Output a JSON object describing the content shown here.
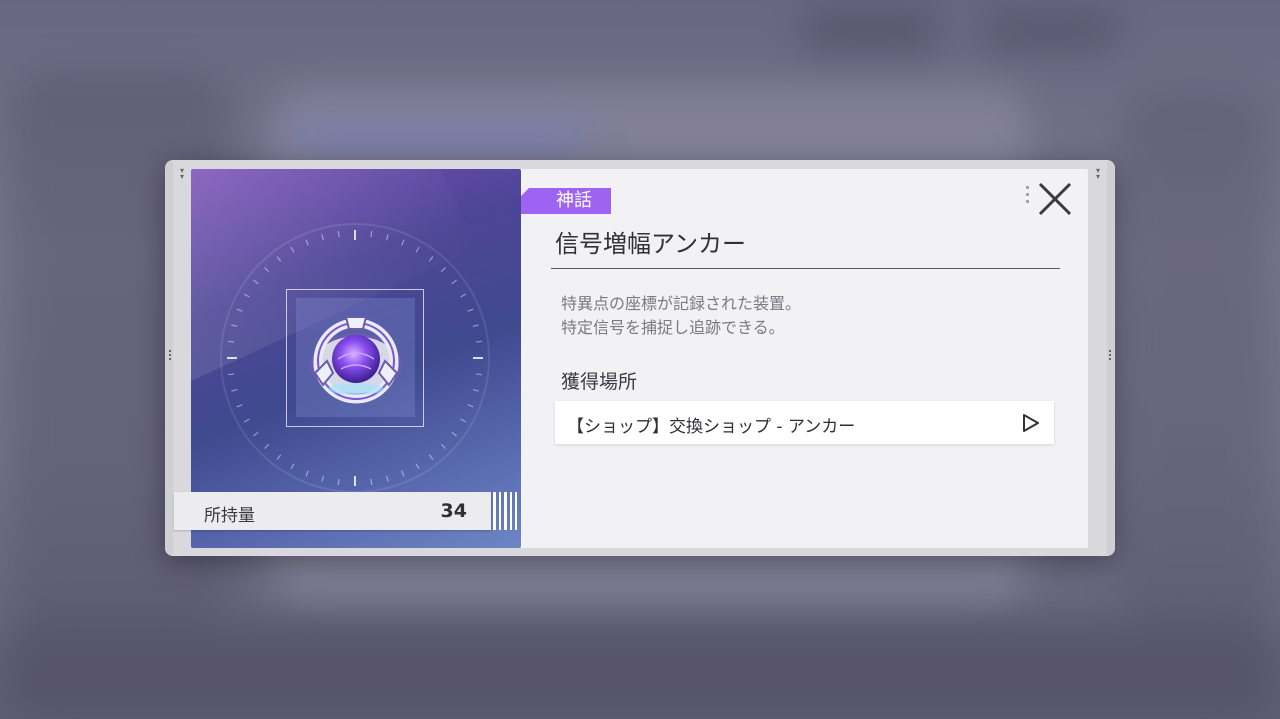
{
  "item": {
    "rarity": "神話",
    "name": "信号増幅アンカー",
    "description": [
      "特異点の座標が記録された装置。",
      "特定信号を捕捉し追跡できる。"
    ],
    "icon": "signal-amplifier-anchor-icon"
  },
  "quantity": {
    "label": "所持量",
    "value": "34"
  },
  "acquisition": {
    "title": "獲得場所",
    "sources": [
      {
        "label": "【ショップ】交換ショップ - アンカー",
        "icon": "play-arrow-icon"
      }
    ]
  },
  "colors": {
    "rarity_badge": "#9f63f2",
    "art_bg_top": "#7a4fb8",
    "art_bg_bottom": "#6d86c4",
    "panel_bg": "#f2f2f4"
  },
  "close_icon": "close-icon"
}
